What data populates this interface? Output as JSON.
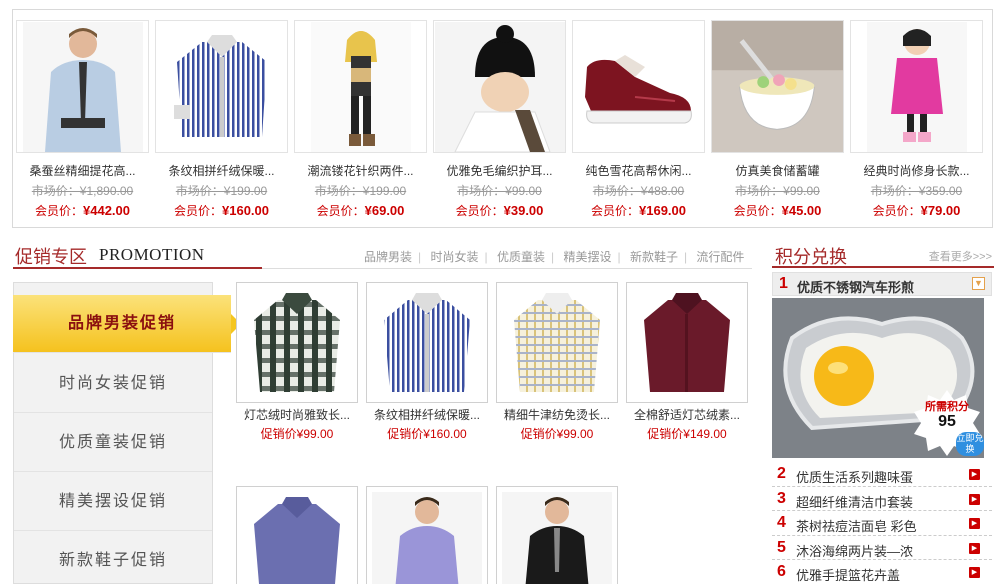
{
  "top_products": [
    {
      "name": "桑蚕丝精细提花高...",
      "market": "市场价：¥1,890.00",
      "member_label": "会员价：",
      "member_price": "¥442.00",
      "icon": "mens-dress-shirt-model"
    },
    {
      "name": "条纹相拼纤绒保暖...",
      "market": "市场价：¥199.00",
      "member_label": "会员价：",
      "member_price": "¥160.00",
      "icon": "striped-shirt"
    },
    {
      "name": "潮流镂花针织两件...",
      "market": "市场价：¥199.00",
      "member_label": "会员价：",
      "member_price": "¥69.00",
      "icon": "fashion-model"
    },
    {
      "name": "优雅免毛编织护耳...",
      "market": "市场价：¥99.00",
      "member_label": "会员价：",
      "member_price": "¥39.00",
      "icon": "knit-hat-model"
    },
    {
      "name": "纯色雪花高帮休闲...",
      "market": "市场价：¥488.00",
      "member_label": "会员价：",
      "member_price": "¥169.00",
      "icon": "red-sneaker"
    },
    {
      "name": "仿真美食储蓄罐",
      "market": "市场价：¥99.00",
      "member_label": "会员价：",
      "member_price": "¥45.00",
      "icon": "food-bowl"
    },
    {
      "name": "经典时尚修身长款...",
      "market": "市场价：¥359.00",
      "member_label": "会员价：",
      "member_price": "¥79.00",
      "icon": "child-pink-coat"
    }
  ],
  "promotion": {
    "title_cn": "促销专区",
    "title_en": "PROMOTION",
    "links": [
      "品牌男装",
      "时尚女装",
      "优质童装",
      "精美摆设",
      "新款鞋子",
      "流行配件"
    ],
    "tabs": [
      "品牌男装促销",
      "时尚女装促销",
      "优质童装促销",
      "精美摆设促销",
      "新款鞋子促销"
    ],
    "active_tab": 0,
    "items": [
      {
        "name": "灯芯绒时尚雅致长...",
        "price": "促销价¥99.00",
        "icon": "plaid-shirt"
      },
      {
        "name": "条纹相拼纤绒保暖...",
        "price": "促销价¥160.00",
        "icon": "striped-shirt"
      },
      {
        "name": "精细牛津纺免烫长...",
        "price": "促销价¥99.00",
        "icon": "check-shirt"
      },
      {
        "name": "全棉舒适灯芯绒素...",
        "price": "促销价¥149.00",
        "icon": "burgundy-shirt"
      },
      {
        "name": "",
        "price": "",
        "icon": "purple-shirt"
      },
      {
        "name": "",
        "price": "",
        "icon": "lavender-shirt-model"
      },
      {
        "name": "",
        "price": "",
        "icon": "black-shirt-model"
      }
    ]
  },
  "points": {
    "title": "积分兑换",
    "more": "查看更多>>>",
    "top_item": {
      "rank": "1",
      "name": "优质不锈钢汽车形煎"
    },
    "badge_label": "所需积分",
    "badge_value": "95",
    "redeem": "立即兑换",
    "list": [
      {
        "rank": "2",
        "name": "优质生活系列趣味蛋"
      },
      {
        "rank": "3",
        "name": "超细纤维清洁巾套装"
      },
      {
        "rank": "4",
        "name": "茶树祛痘洁面皂 彩色"
      },
      {
        "rank": "5",
        "name": "沐浴海绵两片装—浓"
      },
      {
        "rank": "6",
        "name": "优雅手提篮花卉盖"
      }
    ]
  }
}
